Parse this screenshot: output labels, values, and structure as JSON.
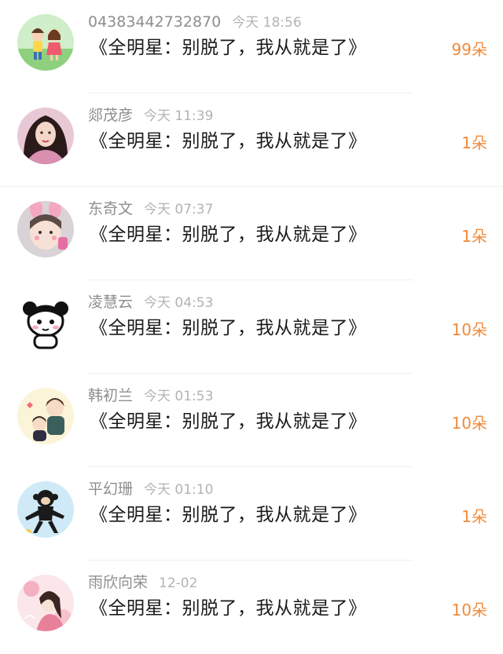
{
  "rows": [
    {
      "name": "04383442732870",
      "time": "今天 18:56",
      "message": "《全明星：别脱了，我从就是了》",
      "count": "99朵",
      "avatar": "boy-girl-cartoon-avatar"
    },
    {
      "name": "郯茂彦",
      "time": "今天 11:39",
      "message": "《全明星：别脱了，我从就是了》",
      "count": "1朵",
      "avatar": "woman-photo-avatar"
    },
    {
      "name": "东奇文",
      "time": "今天 07:37",
      "message": "《全明星：别脱了，我从就是了》",
      "count": "1朵",
      "avatar": "child-bunny-ears-avatar"
    },
    {
      "name": "凌慧云",
      "time": "今天 04:53",
      "message": "《全明星：别脱了，我从就是了》",
      "count": "10朵",
      "avatar": "panda-cartoon-avatar"
    },
    {
      "name": "韩初兰",
      "time": "今天 01:53",
      "message": "《全明星：别脱了，我从就是了》",
      "count": "10朵",
      "avatar": "anime-boys-avatar"
    },
    {
      "name": "平幻珊",
      "time": "今天 01:10",
      "message": "《全明星：别脱了，我从就是了》",
      "count": "1朵",
      "avatar": "monkey-cartoon-avatar"
    },
    {
      "name": "雨欣向荣",
      "time": "12-02",
      "message": "《全明星：别脱了，我从就是了》",
      "count": "10朵",
      "avatar": "pink-flower-girl-avatar"
    }
  ]
}
